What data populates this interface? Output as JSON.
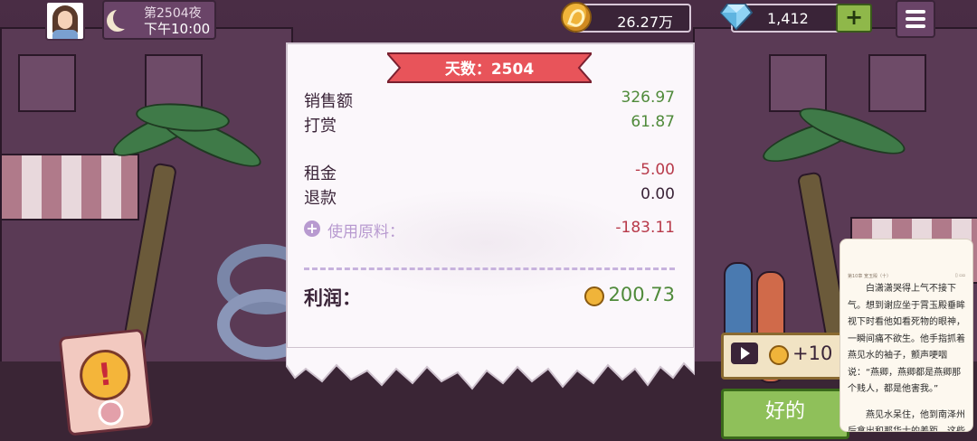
{
  "hud": {
    "day_label": "第2504夜",
    "time_label": "下午10:00",
    "coins": "26.27万",
    "gems": "1,412",
    "add_gems_label": "+",
    "icons": {
      "avatar": "player-avatar",
      "moon": "moon-icon",
      "coin": "coin-icon",
      "gem": "diamond-icon",
      "menu": "hamburger-menu-icon"
    }
  },
  "receipt": {
    "banner": "天数：2504",
    "rows": [
      {
        "label": "销售额",
        "value": "326.97"
      },
      {
        "label": "打赏",
        "value": "61.87"
      },
      {
        "label": "租金",
        "value": "-5.00"
      },
      {
        "label": "退款",
        "value": "0.00"
      },
      {
        "label": "使用原料：",
        "value": "-183.11"
      }
    ],
    "profit_label": "利润：",
    "profit_value": "200.73"
  },
  "ad_reward": {
    "label": "+10"
  },
  "ok_button": "好的",
  "novel": {
    "chapter": "第10章 宽玉殿（十）",
    "paragraphs": [
      "白潇潇哭得上气不接下气。想到谢应坐于霄玉殿垂眸视下时看他如看死物的眼神，一瞬间痛不欲生。他手指抓着燕见水的袖子，颤声哽咽说：“燕卿，燕卿都是燕卿那个贱人，都是他害我。”",
      "燕见水呆住，他到南泽州后拿出和那华士的差距，这些"
    ]
  },
  "colors": {
    "positive": "#4f8a3a",
    "negative": "#b83a4a",
    "neutral": "#3a2438",
    "banner": "#e8545a"
  }
}
